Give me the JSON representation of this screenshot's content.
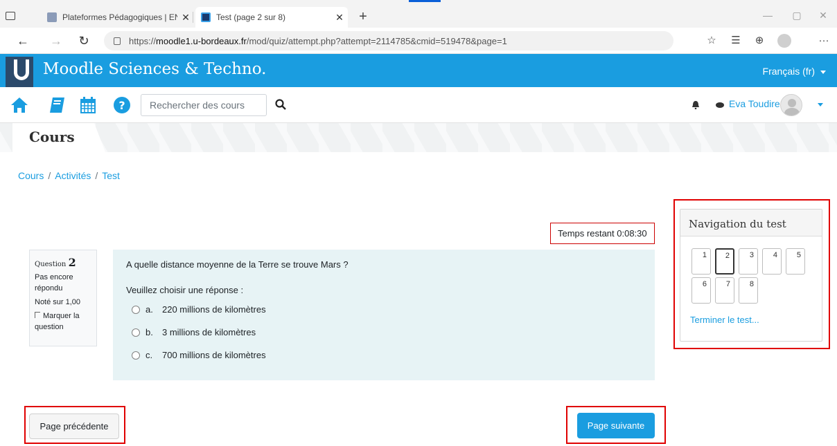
{
  "browser": {
    "tabs": [
      {
        "title": "Plateformes Pédagogiques | ENT"
      },
      {
        "title": "Test (page 2 sur 8)"
      }
    ],
    "url_prefix": "https://",
    "url_host": "moodle1.u-bordeaux.fr",
    "url_path": "/mod/quiz/attempt.php?attempt=2114785&cmid=519478&page=1",
    "new_tab": "+",
    "close_glyph": "✕"
  },
  "site": {
    "name": "Moodle Sciences & Techno.",
    "language": "Français (fr)",
    "brand_color": "#1a9de0"
  },
  "nav": {
    "search_placeholder": "Rechercher des cours",
    "user_name": "Eva Toudire",
    "icons": [
      "home-icon",
      "book-icon",
      "calendar-icon",
      "help-icon",
      "search-icon",
      "bell-icon",
      "message-icon"
    ]
  },
  "page": {
    "header_title": "Cours",
    "breadcrumb": [
      "Cours",
      "Activités",
      "Test"
    ]
  },
  "quiz": {
    "time_remaining": "Temps restant 0:08:30",
    "question_label": "Question",
    "question_number": "2",
    "status": "Pas encore répondu",
    "grade": "Noté sur 1,00",
    "flag_label": "Marquer la question",
    "question_text": "A quelle distance moyenne de la Terre se trouve Mars ?",
    "prompt": "Veuillez choisir une réponse :",
    "answers": [
      {
        "letter": "a.",
        "text": "220 millions de kilomètres"
      },
      {
        "letter": "b.",
        "text": "3 millions de kilomètres"
      },
      {
        "letter": "c.",
        "text": "700 millions de kilomètres"
      }
    ],
    "navigation_title": "Navigation du test",
    "question_buttons": [
      "1",
      "2",
      "3",
      "4",
      "5",
      "6",
      "7",
      "8"
    ],
    "current_question": "2",
    "finish_link": "Terminer le test...",
    "prev_button": "Page précédente",
    "next_button": "Page suivante"
  }
}
